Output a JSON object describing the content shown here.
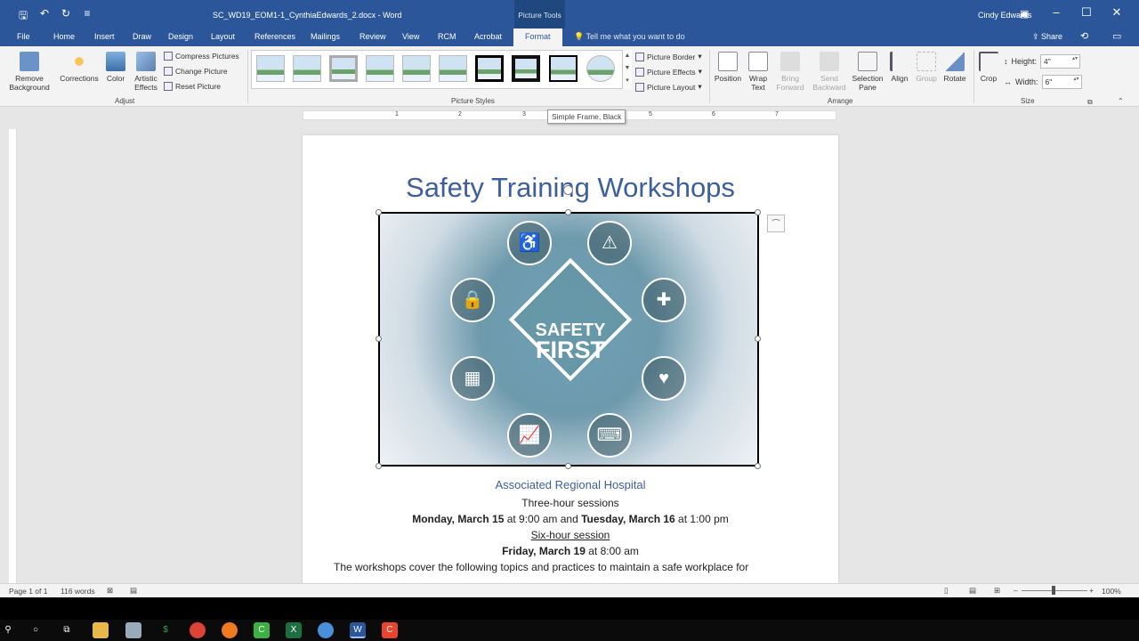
{
  "window": {
    "title": "SC_WD19_EOM1-1_CynthiaEdwards_2.docx  -  Word",
    "context_group": "Picture Tools",
    "user": "Cindy Edwards"
  },
  "tabs": [
    "File",
    "Home",
    "Insert",
    "Draw",
    "Design",
    "Layout",
    "References",
    "Mailings",
    "Review",
    "View",
    "RCM",
    "Acrobat",
    "Format"
  ],
  "active_tab": "Format",
  "tell_me": "Tell me what you want to do",
  "share": "Share",
  "ribbon": {
    "adjust": {
      "remove_background": "Remove Background",
      "corrections": "Corrections",
      "color": "Color",
      "artistic_effects": "Artistic Effects",
      "compress": "Compress Pictures",
      "change": "Change Picture",
      "reset": "Reset Picture",
      "label": "Adjust"
    },
    "styles": {
      "label": "Picture Styles",
      "border": "Picture Border",
      "effects": "Picture Effects",
      "layout": "Picture Layout"
    },
    "arrange": {
      "position": "Position",
      "wrap_text": "Wrap Text",
      "bring_forward": "Bring Forward",
      "send_backward": "Send Backward",
      "selection_pane": "Selection Pane",
      "align": "Align",
      "group": "Group",
      "rotate": "Rotate",
      "label": "Arrange"
    },
    "size": {
      "crop": "Crop",
      "height_label": "Height:",
      "height": "4\"",
      "width_label": "Width:",
      "width": "6\"",
      "label": "Size"
    }
  },
  "tooltip": "Simple Frame, Black",
  "document": {
    "title": "Safety Training Workshops",
    "image_text": {
      "line1": "SAFETY",
      "line2": "FIRST"
    },
    "org": "Associated Regional Hospital",
    "sessions1": "Three-hour sessions",
    "date1_bold": "Monday, March 15",
    "date1_mid": " at 9:00 am and ",
    "date2_bold": "Tuesday, March 16",
    "date2_end": " at 1:00 pm",
    "sessions2": "Six-hour session",
    "date3_bold": "Friday, March 19",
    "date3_end": " at 8:00 am",
    "body": "The workshops cover the following topics and practices to maintain a safe workplace for"
  },
  "status": {
    "page": "Page 1 of 1",
    "words": "116 words",
    "zoom": "100%"
  },
  "colors": {
    "accent": "#2b579a",
    "title": "#3d5f9f"
  }
}
